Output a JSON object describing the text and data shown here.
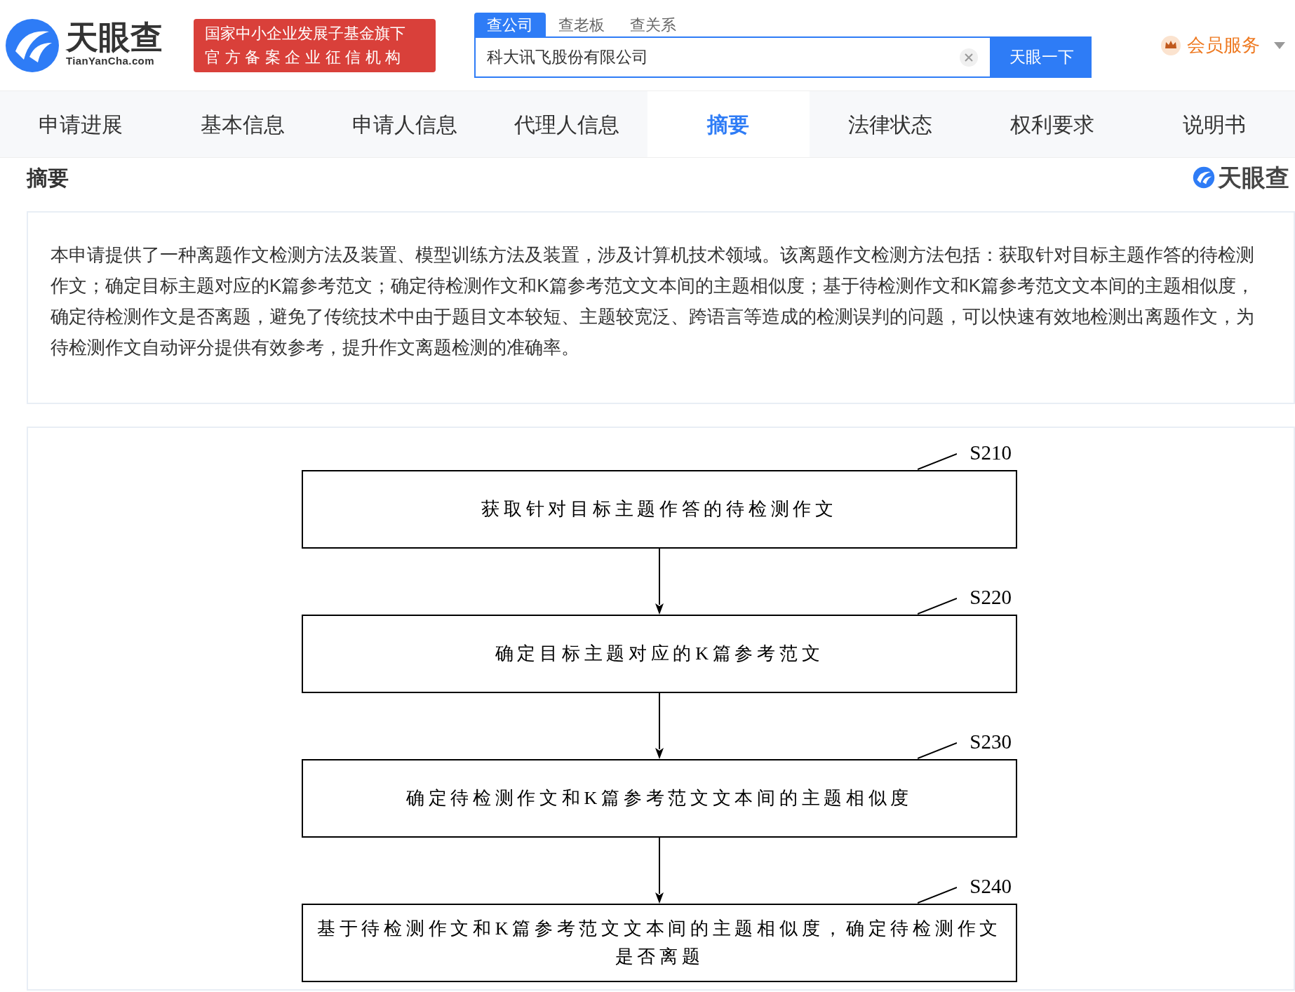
{
  "header": {
    "logo": {
      "name": "天眼查",
      "domain": "TianYanCha.com"
    },
    "badge": [
      "国家中小企业发展子基金旗下",
      "官方备案企业征信机构"
    ],
    "search_tabs": [
      {
        "label": "查公司",
        "selected": true
      },
      {
        "label": "查老板",
        "selected": false
      },
      {
        "label": "查关系",
        "selected": false
      }
    ],
    "search": {
      "value": "科大讯飞股份有限公司",
      "button": "天眼一下"
    },
    "member": "会员服务"
  },
  "tabs": [
    {
      "label": "申请进展",
      "selected": false
    },
    {
      "label": "基本信息",
      "selected": false
    },
    {
      "label": "申请人信息",
      "selected": false
    },
    {
      "label": "代理人信息",
      "selected": false
    },
    {
      "label": "摘要",
      "selected": true
    },
    {
      "label": "法律状态",
      "selected": false
    },
    {
      "label": "权利要求",
      "selected": false
    },
    {
      "label": "说明书",
      "selected": false
    }
  ],
  "section": {
    "title": "摘要",
    "logo": "天眼查"
  },
  "abstract": "本申请提供了一种离题作文检测方法及装置、模型训练方法及装置，涉及计算机技术领域。该离题作文检测方法包括：获取针对目标主题作答的待检测作文；确定目标主题对应的K篇参考范文；确定待检测作文和K篇参考范文文本间的主题相似度；基于待检测作文和K篇参考范文文本间的主题相似度，确定待检测作文是否离题，避免了传统技术中由于题目文本较短、主题较宽泛、跨语言等造成的检测误判的问题，可以快速有效地检测出离题作文，为待检测作文自动评分提供有效参考，提升作文离题检测的准确率。",
  "flowchart": {
    "steps": [
      {
        "label": "S210",
        "text": "获取针对目标主题作答的待检测作文"
      },
      {
        "label": "S220",
        "text": "确定目标主题对应的K篇参考范文"
      },
      {
        "label": "S230",
        "text": "确定待检测作文和K篇参考范文文本间的主题相似度"
      },
      {
        "label": "S240",
        "text": "基于待检测作文和K篇参考范文文本间的主题相似度，确定待检测作文是否离题"
      }
    ]
  }
}
